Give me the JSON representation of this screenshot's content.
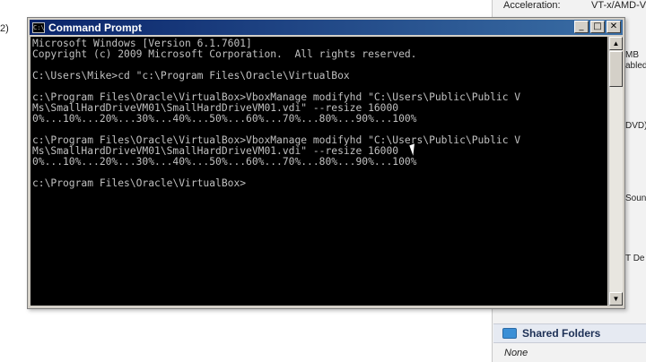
{
  "background": {
    "left_fragment": "2)",
    "vbox_panel": {
      "acceleration_label": "Acceleration:",
      "acceleration_value": "VT-x/AMD-V, Neste",
      "fragments": [
        "MB",
        "abled",
        "DVD)",
        "Sound",
        "T De"
      ],
      "shared_folders_title": "Shared Folders",
      "shared_folders_value": "None",
      "shared_folders_icon": "folder-icon"
    }
  },
  "window": {
    "title": "Command Prompt",
    "controls": {
      "minimize": "_",
      "maximize": "□",
      "close": "✕"
    },
    "console_lines": [
      "Microsoft Windows [Version 6.1.7601]",
      "Copyright (c) 2009 Microsoft Corporation.  All rights reserved.",
      "",
      "C:\\Users\\Mike>cd \"c:\\Program Files\\Oracle\\VirtualBox",
      "",
      "c:\\Program Files\\Oracle\\VirtualBox>VboxManage modifyhd \"C:\\Users\\Public\\Public V",
      "Ms\\SmallHardDriveVM01\\SmallHardDriveVM01.vdi\" --resize 16000",
      "0%...10%...20%...30%...40%...50%...60%...70%...80%...90%...100%",
      "",
      "c:\\Program Files\\Oracle\\VirtualBox>VboxManage modifyhd \"C:\\Users\\Public\\Public V",
      "Ms\\SmallHardDriveVM01\\SmallHardDriveVM01.vdi\" --resize 16000",
      "0%...10%...20%...30%...40%...50%...60%...70%...80%...90%...100%",
      "",
      "c:\\Program Files\\Oracle\\VirtualBox>"
    ],
    "scroll": {
      "up": "▲",
      "down": "▼"
    }
  }
}
